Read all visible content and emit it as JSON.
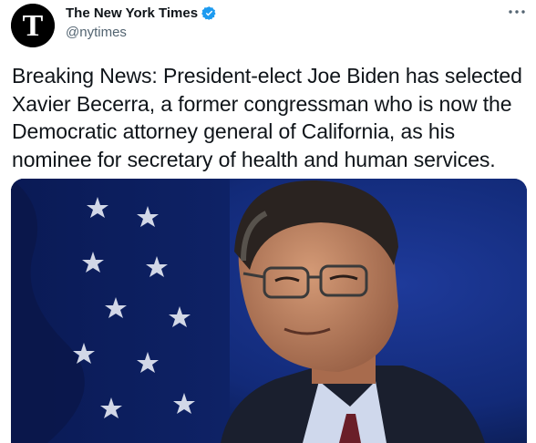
{
  "author": {
    "display_name": "The New York Times",
    "handle": "@nytimes",
    "avatar_icon": "nyt-logo-icon",
    "verified_icon": "verified-badge-icon"
  },
  "tweet": {
    "text": "Breaking News: President-elect Joe Biden has selected Xavier Becerra, a former congressman who is now the Democratic attorney general of California, as his nominee for secretary of health and human services."
  },
  "media": {
    "kind": "photo"
  },
  "colors": {
    "verified": "#1d9bf0",
    "text": "#0f1419",
    "secondary_text": "#536471",
    "flag_blue": "#0d1f5c"
  }
}
